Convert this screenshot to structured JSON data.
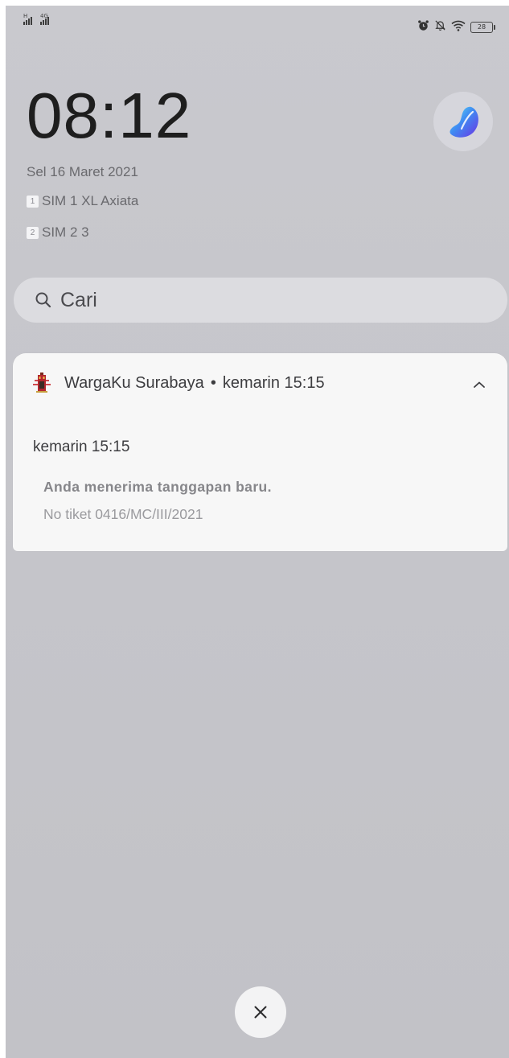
{
  "status_bar": {
    "sim1_network_tag": "H",
    "sim2_network_tag": "4G",
    "icons": [
      "alarm-icon",
      "bell-off-icon",
      "wifi-icon"
    ],
    "battery_level": "28"
  },
  "lockscreen": {
    "time": "08:12",
    "date": "Sel 16 Maret 2021",
    "sims": [
      {
        "slot": "1",
        "label": "SIM 1 XL Axiata"
      },
      {
        "slot": "2",
        "label": "SIM 2 3"
      }
    ]
  },
  "search": {
    "placeholder": "Cari"
  },
  "notification": {
    "app_name": "WargaKu Surabaya",
    "separator": "•",
    "header_time": "kemarin 15:15",
    "sub_time": "kemarin 15:15",
    "title": "Anda menerima tanggapan baru.",
    "body": "No tiket 0416/MC/III/2021",
    "expanded": true
  },
  "colors": {
    "background": "#c6c6cb",
    "card": "#f7f7f7",
    "orb_start": "#5de0f4",
    "orb_end": "#6a3ee8"
  },
  "actions": {
    "close_icon": "close-icon"
  }
}
